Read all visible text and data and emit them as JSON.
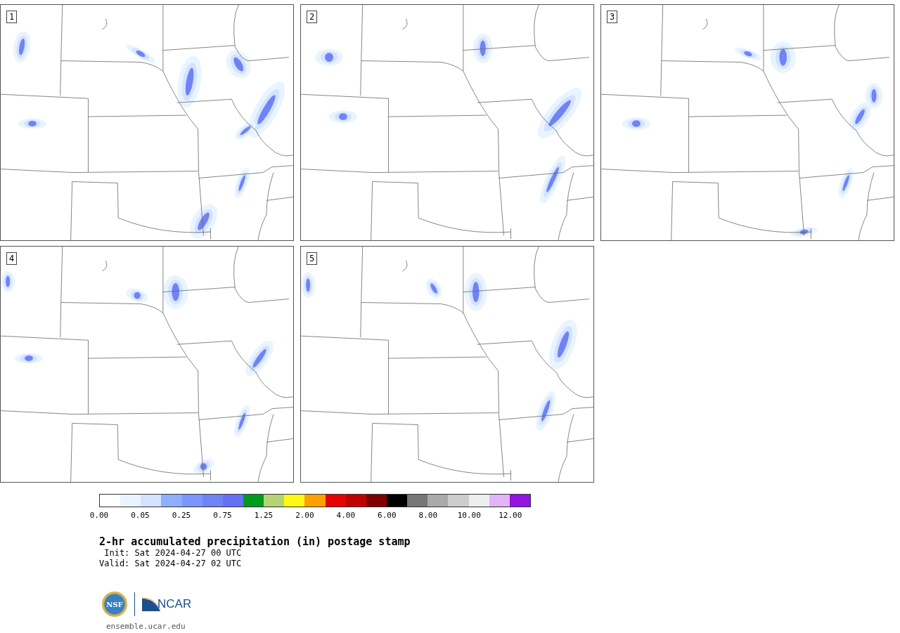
{
  "panels": [
    {
      "label": "1"
    },
    {
      "label": "2"
    },
    {
      "label": "3"
    },
    {
      "label": "4"
    },
    {
      "label": "5"
    }
  ],
  "colorbar": {
    "segments": [
      {
        "color": "#ffffff"
      },
      {
        "color": "#e8f4ff"
      },
      {
        "color": "#d4e2ff"
      },
      {
        "color": "#8cb0ff"
      },
      {
        "color": "#7b96ff"
      },
      {
        "color": "#6f83f7"
      },
      {
        "color": "#6670f5"
      },
      {
        "color": "#009a1e"
      },
      {
        "color": "#b4d473"
      },
      {
        "color": "#fff714"
      },
      {
        "color": "#ffa000"
      },
      {
        "color": "#e60000"
      },
      {
        "color": "#c00000"
      },
      {
        "color": "#800000"
      },
      {
        "color": "#000000"
      },
      {
        "color": "#777777"
      },
      {
        "color": "#aaaaaa"
      },
      {
        "color": "#cccccc"
      },
      {
        "color": "#eeeeee"
      },
      {
        "color": "#e1b4f5"
      },
      {
        "color": "#9313e0"
      }
    ],
    "tick_labels": [
      "0.00",
      "0.05",
      "0.25",
      "0.75",
      "1.25",
      "2.00",
      "4.00",
      "6.00",
      "8.00",
      "10.00",
      "12.00"
    ]
  },
  "title": "2-hr accumulated precipitation (in) postage stamp",
  "init": " Init: Sat 2024-04-27 00 UTC",
  "valid": "Valid: Sat 2024-04-27 02 UTC",
  "logos": {
    "nsf": "NSF",
    "ncar": "NCAR"
  },
  "url": "ensemble.ucar.edu"
}
